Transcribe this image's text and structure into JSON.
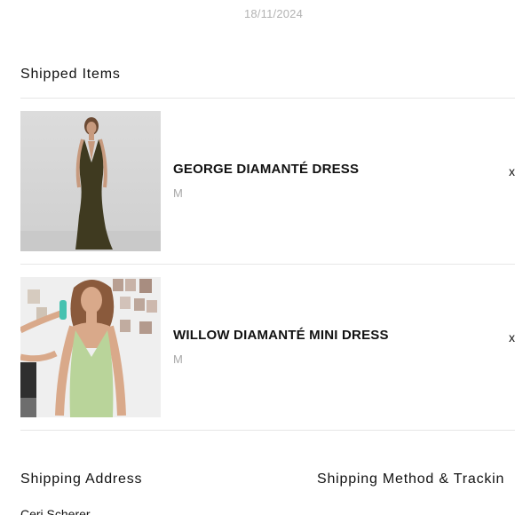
{
  "order": {
    "date": "18/11/2024"
  },
  "shipped_items": {
    "title": "Shipped Items",
    "items": [
      {
        "name": "GEORGE DIAMANTÉ DRESS",
        "size": "M",
        "quantity_prefix": "x"
      },
      {
        "name": "WILLOW DIAMANTÉ MINI DRESS",
        "size": "M",
        "quantity_prefix": "x"
      }
    ]
  },
  "shipping": {
    "address_title": "Shipping Address",
    "method_title": "Shipping Method & Trackin",
    "recipient_name": "Ceri Scherer"
  },
  "colors": {
    "muted_text": "#a8a8a8",
    "divider": "#e6e6e6",
    "dress_1": "#3f3a20",
    "dress_2": "#b9d49a"
  }
}
